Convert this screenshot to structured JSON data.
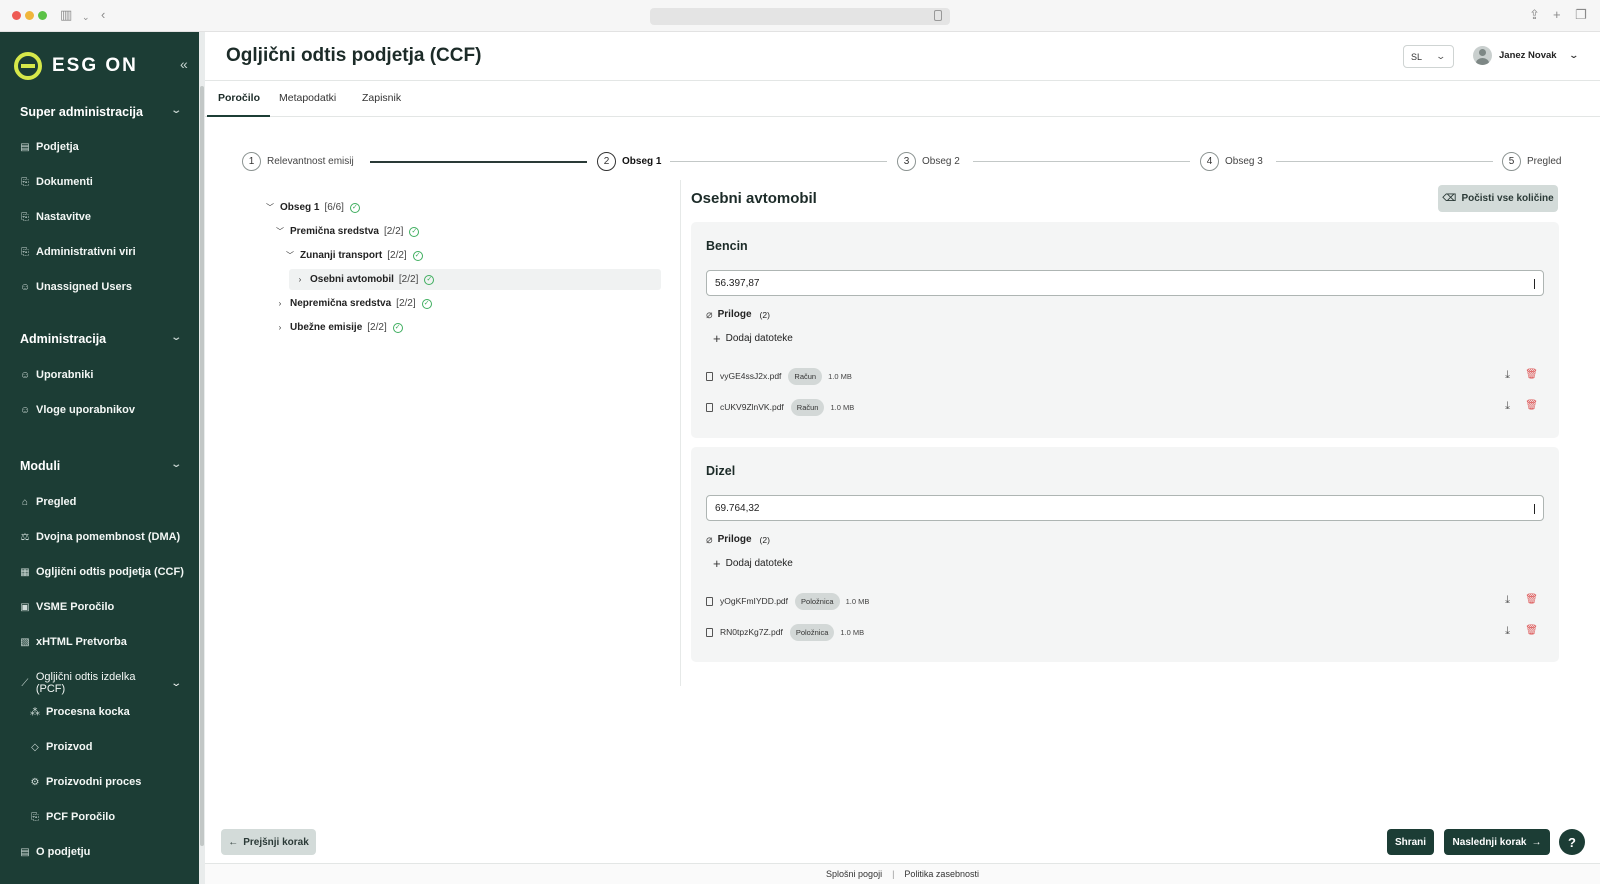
{
  "app": {
    "logo_text": "ESG ON",
    "page_title": "Ogljični odtis podjetja (CCF)",
    "language": "SL",
    "user_name": "Janez Novak"
  },
  "sidebar": {
    "sections": [
      {
        "label": "Super administracija"
      },
      {
        "label": "Administracija"
      },
      {
        "label": "Moduli"
      }
    ],
    "items": [
      {
        "label": "Podjetja",
        "icon": "building-icon"
      },
      {
        "label": "Dokumenti",
        "icon": "document-icon"
      },
      {
        "label": "Nastavitve",
        "icon": "settings-icon"
      },
      {
        "label": "Administrativni viri",
        "icon": "resources-icon"
      },
      {
        "label": "Unassigned Users",
        "icon": "user-icon"
      },
      {
        "label": "Uporabniki",
        "icon": "users-icon"
      },
      {
        "label": "Vloge uporabnikov",
        "icon": "roles-icon"
      },
      {
        "label": "Pregled",
        "icon": "home-icon"
      },
      {
        "label": "Dvojna pomembnost (DMA)",
        "icon": "scale-icon"
      },
      {
        "label": "Ogljični odtis podjetja (CCF)",
        "icon": "factory-icon"
      },
      {
        "label": "VSME Poročilo",
        "icon": "report-icon"
      },
      {
        "label": "xHTML Pretvorba",
        "icon": "convert-icon"
      },
      {
        "label": "Ogljični odtis izdelka (PCF)",
        "icon": "chart-icon"
      },
      {
        "label": "Procesna kocka",
        "icon": "cube-icon"
      },
      {
        "label": "Proizvod",
        "icon": "box-icon"
      },
      {
        "label": "Proizvodni proces",
        "icon": "gear-icon"
      },
      {
        "label": "PCF Poročilo",
        "icon": "file-icon"
      },
      {
        "label": "O podjetju",
        "icon": "company-icon"
      }
    ]
  },
  "tabs": [
    {
      "label": "Poročilo"
    },
    {
      "label": "Metapodatki"
    },
    {
      "label": "Zapisnik"
    }
  ],
  "stepper": [
    {
      "num": "1",
      "label": "Relevantnost emisij"
    },
    {
      "num": "2",
      "label": "Obseg 1"
    },
    {
      "num": "3",
      "label": "Obseg 2"
    },
    {
      "num": "4",
      "label": "Obseg 3"
    },
    {
      "num": "5",
      "label": "Pregled"
    }
  ],
  "tree": [
    {
      "label": "Obseg 1",
      "count": "[6/6]"
    },
    {
      "label": "Premična sredstva",
      "count": "[2/2]"
    },
    {
      "label": "Zunanji transport",
      "count": "[2/2]"
    },
    {
      "label": "Osebni avtomobil",
      "count": "[2/2]"
    },
    {
      "label": "Nepremična sredstva",
      "count": "[2/2]"
    },
    {
      "label": "Ubežne emisije",
      "count": "[2/2]"
    }
  ],
  "detail": {
    "title": "Osebni avtomobil",
    "reset_label": "Počisti vse količine",
    "cards": [
      {
        "title": "Bencin",
        "value": "56.397,87",
        "attachments_label": "Priloge",
        "attachments_count": "(2)",
        "add_label": "Dodaj datoteke",
        "files": [
          {
            "name": "vyGE4ssJ2x.pdf",
            "tag": "Račun",
            "size": "1.0 MB"
          },
          {
            "name": "cUKV9ZlnVK.pdf",
            "tag": "Račun",
            "size": "1.0 MB"
          }
        ]
      },
      {
        "title": "Dizel",
        "value": "69.764,32",
        "attachments_label": "Priloge",
        "attachments_count": "(2)",
        "add_label": "Dodaj datoteke",
        "files": [
          {
            "name": "yOgKFmIYDD.pdf",
            "tag": "Položnica",
            "size": "1.0 MB"
          },
          {
            "name": "RN0tpzKg7Z.pdf",
            "tag": "Položnica",
            "size": "1.0 MB"
          }
        ]
      }
    ]
  },
  "footer": {
    "prev_label": "Prejšnji korak",
    "save_label": "Shrani",
    "next_label": "Naslednji korak",
    "help_label": "?",
    "links": [
      "Splošni pogoji",
      "Politika zasebnosti"
    ]
  },
  "colors": {
    "sidebar_bg": "#1c3d35",
    "accent": "#d6e84a",
    "success": "#3fae5f",
    "danger": "#dd5656"
  }
}
